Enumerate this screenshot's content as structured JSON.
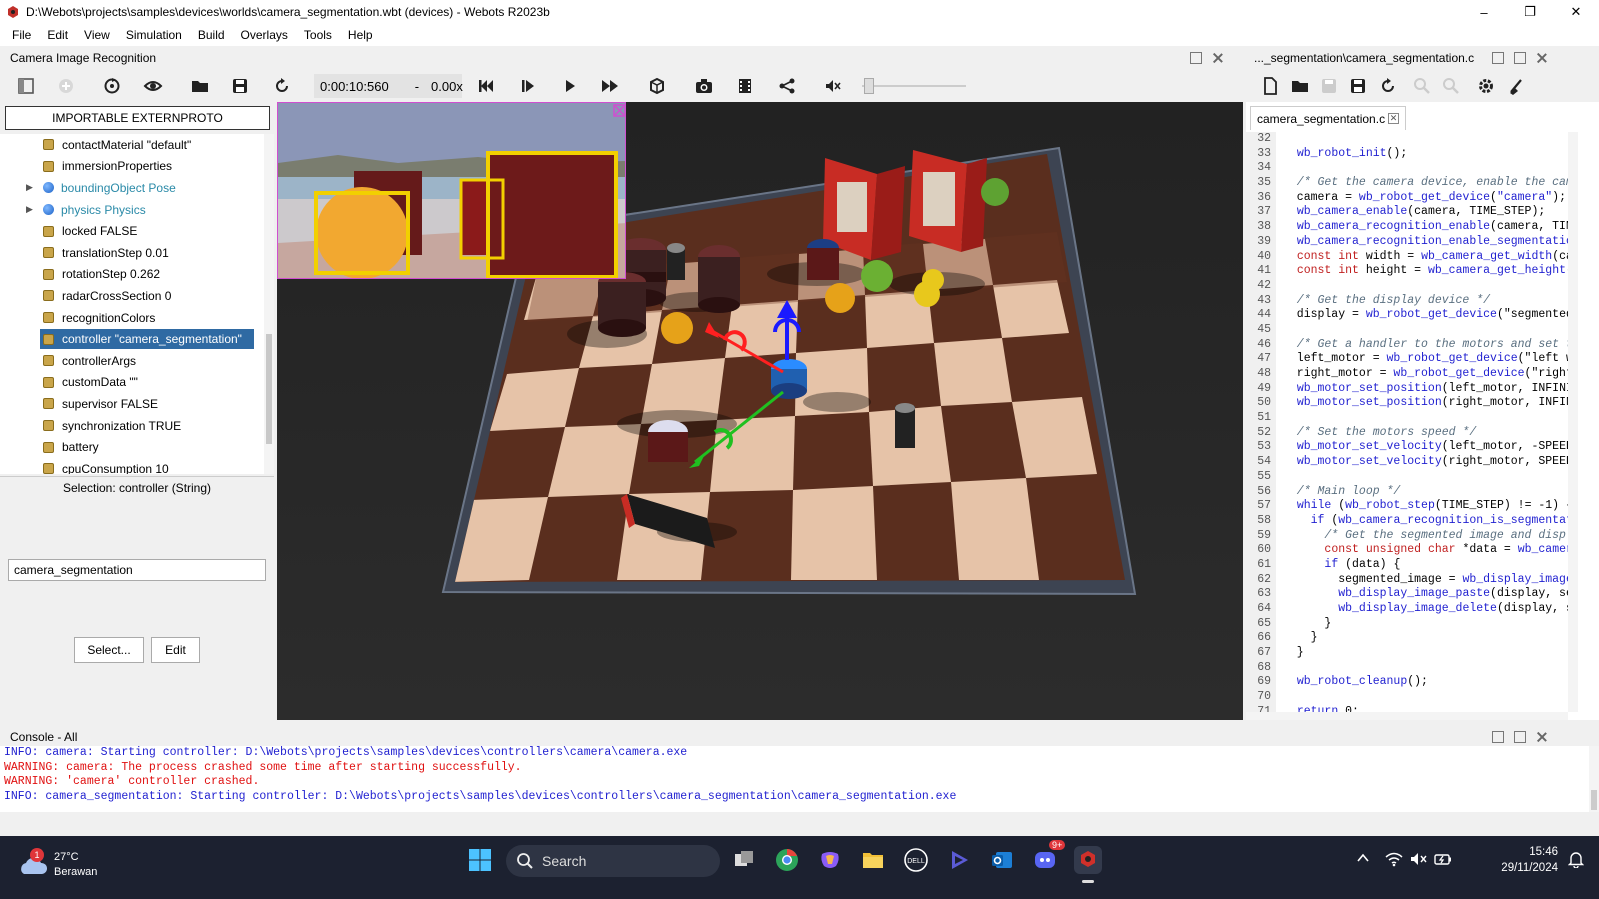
{
  "window": {
    "title": "D:\\Webots\\projects\\samples\\devices\\worlds\\camera_segmentation.wbt (devices) - Webots R2023b",
    "min_label": "–",
    "max_label": "❐",
    "close_label": "✕"
  },
  "menu": [
    "File",
    "Edit",
    "View",
    "Simulation",
    "Build",
    "Overlays",
    "Tools",
    "Help"
  ],
  "scene_dock": {
    "title": "Camera Image Recognition"
  },
  "editor_dock": {
    "title": "..._segmentation\\camera_segmentation.c"
  },
  "toolbar": {
    "time": "0:00:10:560",
    "time_sep": "-",
    "speed": "0.00x"
  },
  "scene_tree": {
    "extern_button": "IMPORTABLE EXTERNPROTO",
    "items": [
      {
        "label": "contactMaterial \"default\"",
        "icon": "field-icon"
      },
      {
        "label": "immersionProperties",
        "icon": "field-icon"
      },
      {
        "label": "boundingObject Pose",
        "icon": "node-icon"
      },
      {
        "label": "physics Physics",
        "icon": "node-icon"
      },
      {
        "label": "locked FALSE",
        "icon": "field-icon"
      },
      {
        "label": "translationStep 0.01",
        "icon": "field-icon"
      },
      {
        "label": "rotationStep 0.262",
        "icon": "field-icon"
      },
      {
        "label": "radarCrossSection 0",
        "icon": "field-icon"
      },
      {
        "label": "recognitionColors",
        "icon": "field-icon"
      },
      {
        "label": "controller \"camera_segmentation\"",
        "icon": "field-icon"
      },
      {
        "label": "controllerArgs",
        "icon": "field-icon"
      },
      {
        "label": "customData \"\"",
        "icon": "field-icon"
      },
      {
        "label": "supervisor FALSE",
        "icon": "field-icon"
      },
      {
        "label": "synchronization TRUE",
        "icon": "field-icon"
      },
      {
        "label": "battery",
        "icon": "field-icon"
      },
      {
        "label": "cpuConsumption 10",
        "icon": "field-icon"
      }
    ]
  },
  "field_editor": {
    "selection": "Selection: controller (String)",
    "value": "camera_segmentation",
    "select_button": "Select...",
    "edit_button": "Edit"
  },
  "editor": {
    "tab": "camera_segmentation.c",
    "lines": [
      {
        "n": "32",
        "t": ""
      },
      {
        "n": "33",
        "t": "  wb_robot_init();"
      },
      {
        "n": "34",
        "t": ""
      },
      {
        "n": "35",
        "t": "  /* Get the camera device, enable the cam"
      },
      {
        "n": "36",
        "t": "  camera = wb_robot_get_device(\"camera\");"
      },
      {
        "n": "37",
        "t": "  wb_camera_enable(camera, TIME_STEP);"
      },
      {
        "n": "38",
        "t": "  wb_camera_recognition_enable(camera, TIM"
      },
      {
        "n": "39",
        "t": "  wb_camera_recognition_enable_segmentatio"
      },
      {
        "n": "40",
        "t": "  const int width = wb_camera_get_width(ca"
      },
      {
        "n": "41",
        "t": "  const int height = wb_camera_get_height("
      },
      {
        "n": "42",
        "t": ""
      },
      {
        "n": "43",
        "t": "  /* Get the display device */"
      },
      {
        "n": "44",
        "t": "  display = wb_robot_get_device(\"segmented"
      },
      {
        "n": "45",
        "t": ""
      },
      {
        "n": "46",
        "t": "  /* Get a handler to the motors and set t"
      },
      {
        "n": "47",
        "t": "  left_motor = wb_robot_get_device(\"left w"
      },
      {
        "n": "48",
        "t": "  right_motor = wb_robot_get_device(\"right"
      },
      {
        "n": "49",
        "t": "  wb_motor_set_position(left_motor, INFINI"
      },
      {
        "n": "50",
        "t": "  wb_motor_set_position(right_motor, INFIN"
      },
      {
        "n": "51",
        "t": ""
      },
      {
        "n": "52",
        "t": "  /* Set the motors speed */"
      },
      {
        "n": "53",
        "t": "  wb_motor_set_velocity(left_motor, -SPEED"
      },
      {
        "n": "54",
        "t": "  wb_motor_set_velocity(right_motor, SPEED"
      },
      {
        "n": "55",
        "t": ""
      },
      {
        "n": "56",
        "t": "  /* Main loop */"
      },
      {
        "n": "57",
        "t": "  while (wb_robot_step(TIME_STEP) != -1) {"
      },
      {
        "n": "58",
        "t": "    if (wb_camera_recognition_is_segmentat"
      },
      {
        "n": "59",
        "t": "      /* Get the segmented image and displ"
      },
      {
        "n": "60",
        "t": "      const unsigned char *data = wb_camer"
      },
      {
        "n": "61",
        "t": "      if (data) {"
      },
      {
        "n": "62",
        "t": "        segmented_image = wb_display_image"
      },
      {
        "n": "63",
        "t": "        wb_display_image_paste(display, se"
      },
      {
        "n": "64",
        "t": "        wb_display_image_delete(display, s"
      },
      {
        "n": "65",
        "t": "      }"
      },
      {
        "n": "66",
        "t": "    }"
      },
      {
        "n": "67",
        "t": "  }"
      },
      {
        "n": "68",
        "t": ""
      },
      {
        "n": "69",
        "t": "  wb_robot_cleanup();"
      },
      {
        "n": "70",
        "t": ""
      },
      {
        "n": "71",
        "t": "  return 0;"
      }
    ]
  },
  "console": {
    "title": "Console - All",
    "lines": [
      {
        "type": "info",
        "text": "INFO: camera: Starting controller: D:\\Webots\\projects\\samples\\devices\\controllers\\camera\\camera.exe"
      },
      {
        "type": "warn",
        "text": "WARNING: camera: The process crashed some time after starting successfully."
      },
      {
        "type": "warn",
        "text": "WARNING: 'camera' controller crashed."
      },
      {
        "type": "info",
        "text": "INFO: camera_segmentation: Starting controller: D:\\Webots\\projects\\samples\\devices\\controllers\\camera_segmentation\\camera_segmentation.exe"
      }
    ]
  },
  "taskbar": {
    "weather_temp": "27°C",
    "weather_desc": "Berawan",
    "weather_badge": "1",
    "search_label": "Search",
    "discord_badge": "9+",
    "time": "15:46",
    "date": "29/11/2024"
  },
  "colors": {
    "selection": "#2f6aa3",
    "info_text": "#1f1fd0",
    "warning_text": "#e01010",
    "taskbar_bg": "#1c2130",
    "overlay_border": "#d04fd0",
    "recognition_box": "#f2d000"
  }
}
